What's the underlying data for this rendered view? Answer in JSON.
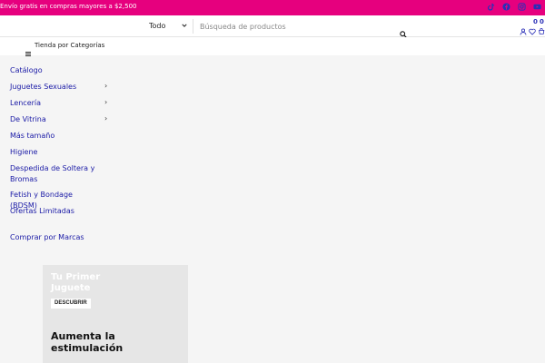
{
  "topbar": {
    "promo": "Envío gratis en compras mayores a $2,500",
    "social": [
      "tiktok-icon",
      "facebook-icon",
      "instagram-icon",
      "youtube-icon"
    ]
  },
  "header": {
    "category_select": "Todo",
    "search_placeholder": "Búsqueda de productos",
    "wishlist_count": "0",
    "cart_count": "0"
  },
  "catbar": {
    "label": "Tienda por Categorías"
  },
  "menu": {
    "items": [
      {
        "label": "Catálogo"
      },
      {
        "label": "Juguetes Sexuales"
      },
      {
        "label": "Lencería"
      },
      {
        "label": "De Vitrina"
      },
      {
        "label": "Más tamaño"
      },
      {
        "label": "Higiene"
      },
      {
        "label": "Despedida de Soltera y Bromas"
      },
      {
        "label": "Fetish y Bondage (BDSM)"
      },
      {
        "label": "Ofertas Limitadas"
      },
      {
        "label": "Comprar por Marcas"
      }
    ]
  },
  "promo_card": {
    "title": "Tu Primer Juguete",
    "button": "DESCUBRIR",
    "headline": "Aumenta la estimulación"
  },
  "colors": {
    "accent": "#e6007e",
    "link": "#1a1aa6",
    "icon": "#2a2fb7"
  }
}
